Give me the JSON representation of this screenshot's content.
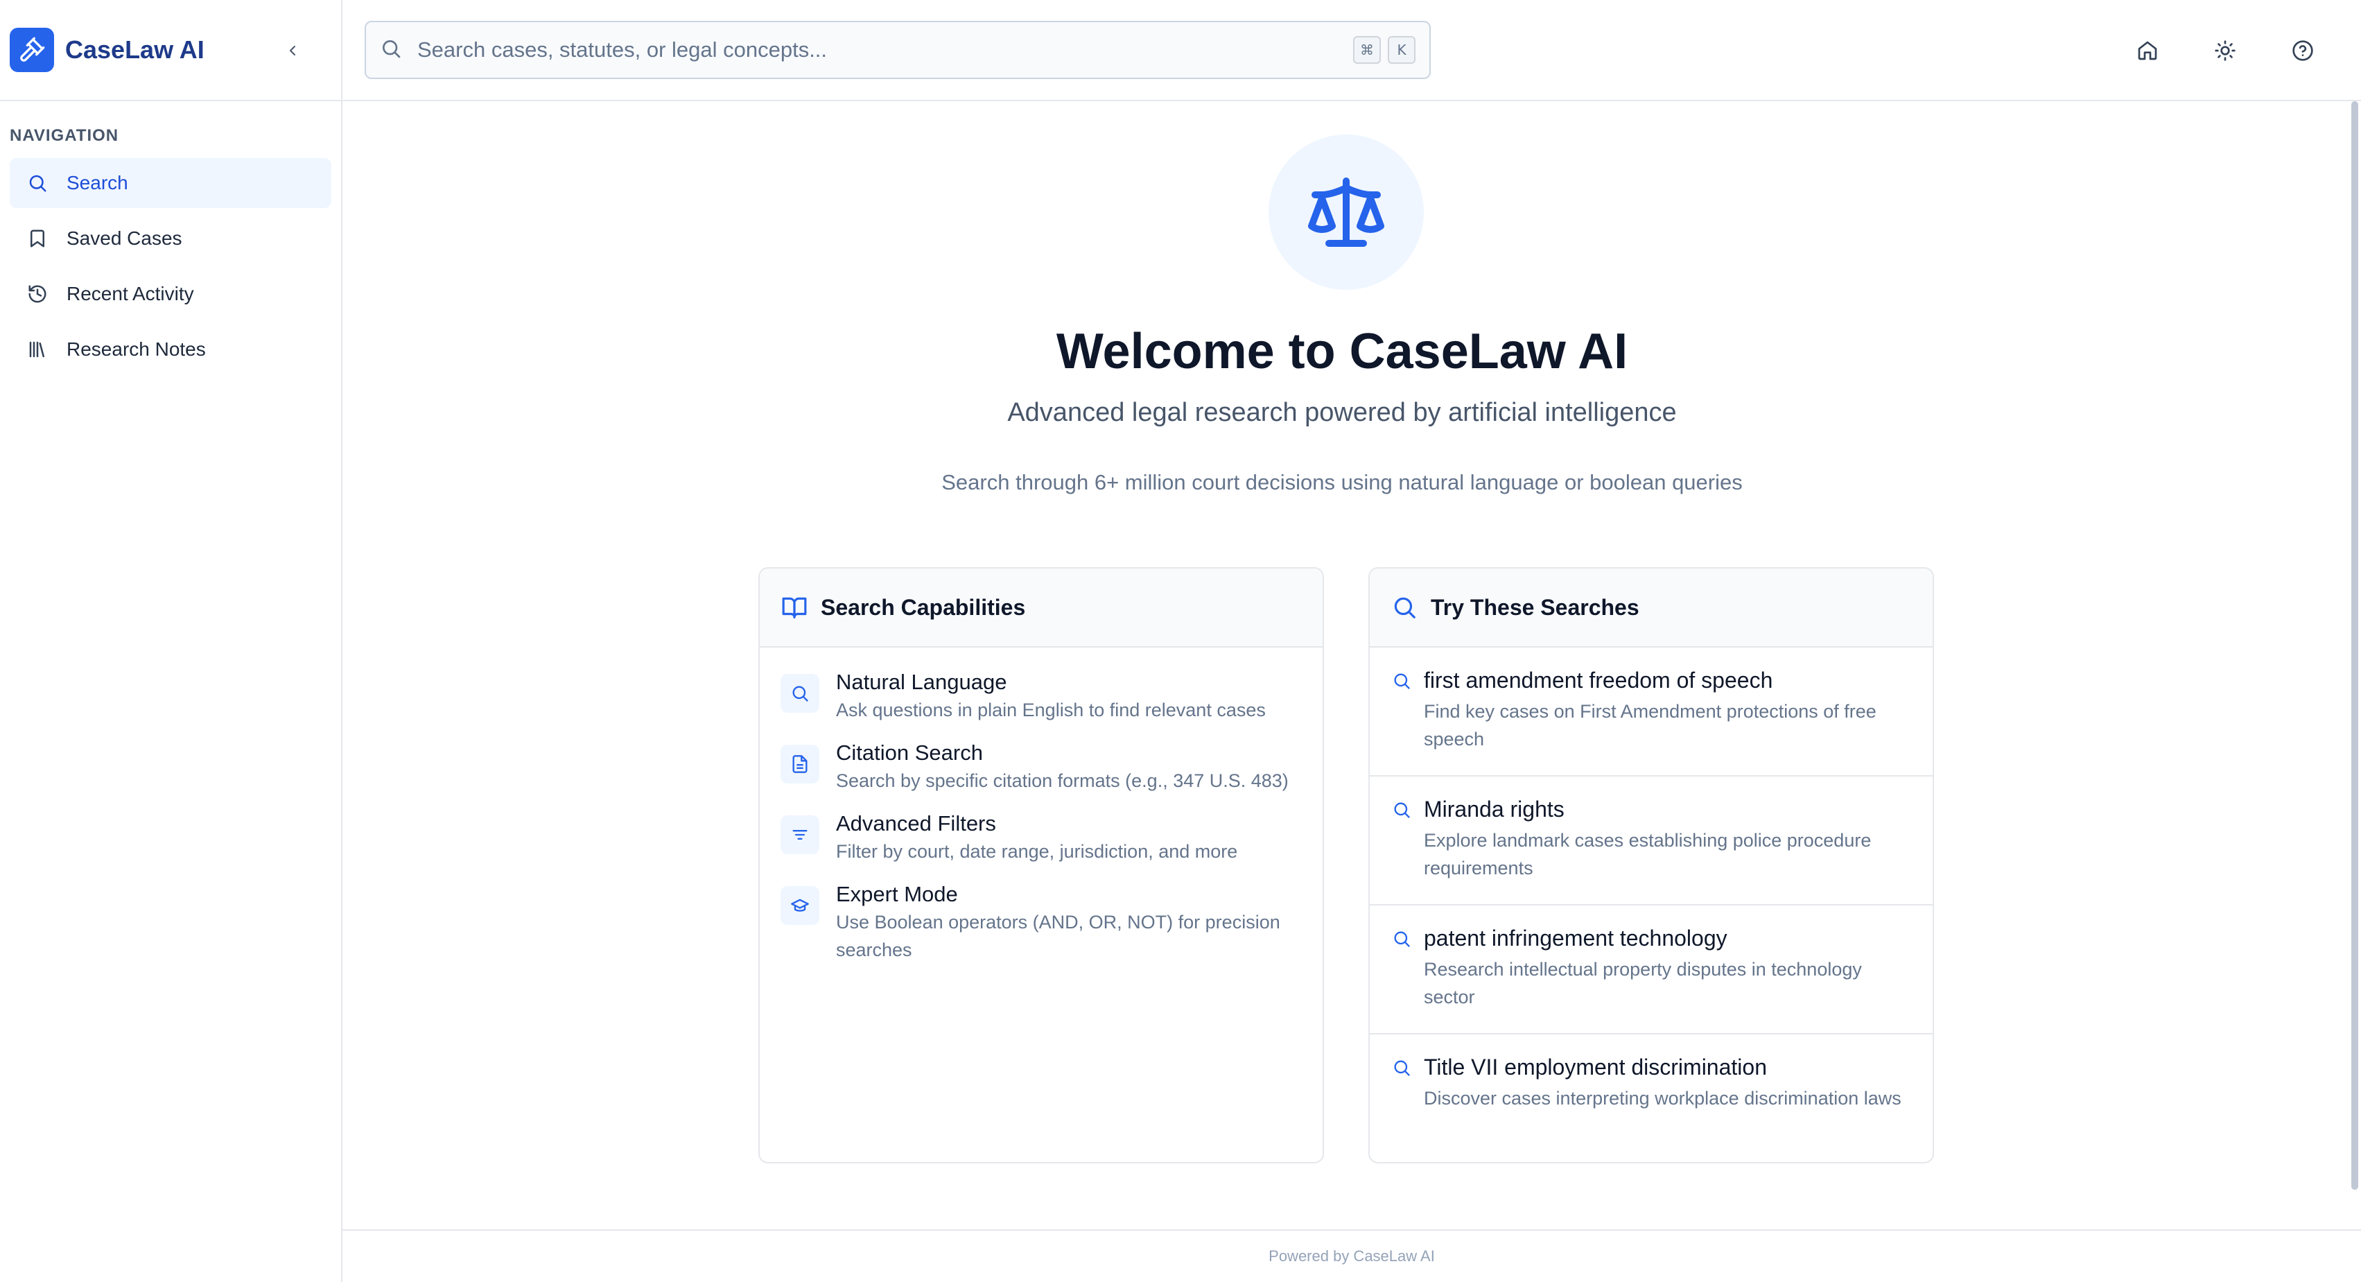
{
  "app": {
    "name": "CaseLaw AI"
  },
  "sidebar": {
    "heading": "NAVIGATION",
    "items": [
      {
        "label": "Search",
        "icon": "search-icon",
        "active": true
      },
      {
        "label": "Saved Cases",
        "icon": "bookmark-icon",
        "active": false
      },
      {
        "label": "Recent Activity",
        "icon": "history-icon",
        "active": false
      },
      {
        "label": "Research Notes",
        "icon": "library-icon",
        "active": false
      }
    ]
  },
  "search": {
    "placeholder": "Search cases, statutes, or legal concepts...",
    "shortcut_keys": [
      "⌘",
      "K"
    ]
  },
  "topbar_icons": [
    "home-icon",
    "sun-icon",
    "help-icon"
  ],
  "hero": {
    "icon": "scale-icon",
    "title": "Welcome to CaseLaw AI",
    "subtitle": "Advanced legal research powered by artificial intelligence",
    "description": "Search through 6+ million court decisions using natural language or boolean queries"
  },
  "capabilities": {
    "title": "Search Capabilities",
    "items": [
      {
        "title": "Natural Language",
        "desc": "Ask questions in plain English to find relevant cases",
        "icon": "search-icon"
      },
      {
        "title": "Citation Search",
        "desc": "Search by specific citation formats (e.g., 347 U.S. 483)",
        "icon": "document-icon"
      },
      {
        "title": "Advanced Filters",
        "desc": "Filter by court, date range, jurisdiction, and more",
        "icon": "filter-icon"
      },
      {
        "title": "Expert Mode",
        "desc": "Use Boolean operators (AND, OR, NOT) for precision searches",
        "icon": "graduation-cap-icon"
      }
    ]
  },
  "try_searches": {
    "title": "Try These Searches",
    "items": [
      {
        "title": "first amendment freedom of speech",
        "desc": "Find key cases on First Amendment protections of free speech"
      },
      {
        "title": "Miranda rights",
        "desc": "Explore landmark cases establishing police procedure requirements"
      },
      {
        "title": "patent infringement technology",
        "desc": "Research intellectual property disputes in technology sector"
      },
      {
        "title": "Title VII employment discrimination",
        "desc": "Discover cases interpreting workplace discrimination laws"
      }
    ]
  },
  "footer": {
    "text": "Powered by CaseLaw AI"
  },
  "colors": {
    "accent": "#2563eb",
    "active_bg": "#eff6ff",
    "brand_text": "#1e3a8a"
  }
}
